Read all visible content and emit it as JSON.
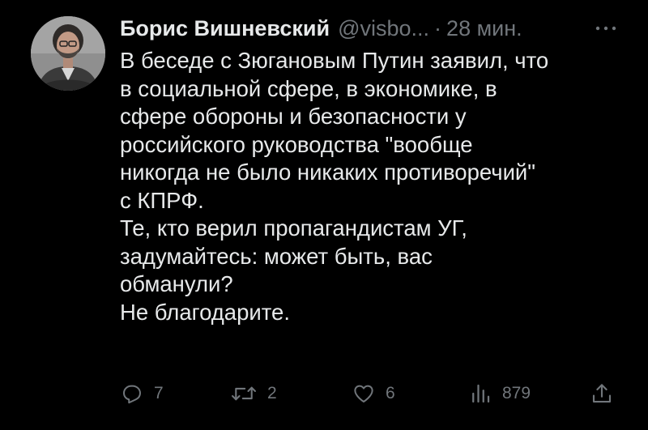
{
  "author": {
    "name": "Борис Вишневский",
    "handle": "@visbo...",
    "separator": "·",
    "time": "28 мин."
  },
  "tweet": {
    "paragraphs": [
      "В беседе с Зюгановым Путин заявил, что",
      "в социальной сфере, в экономике, в",
      "сфере обороны и безопасности у",
      "российского руководства \"вообще",
      "никогда не было никаких противоречий\"",
      "с КПРФ.",
      "Те, кто верил пропагандистам УГ,",
      "задумайтесь: может быть, вас",
      "обманули?",
      "Не благодарите."
    ]
  },
  "actions": {
    "reply": {
      "icon": "reply-icon",
      "count": "7"
    },
    "retweet": {
      "icon": "retweet-icon",
      "count": "2"
    },
    "like": {
      "icon": "heart-icon",
      "count": "6"
    },
    "views": {
      "icon": "views-icon",
      "count": "879"
    },
    "share": {
      "icon": "share-icon"
    }
  },
  "colors": {
    "background": "#000000",
    "text": "#e7e9ea",
    "secondary": "#71767b"
  }
}
